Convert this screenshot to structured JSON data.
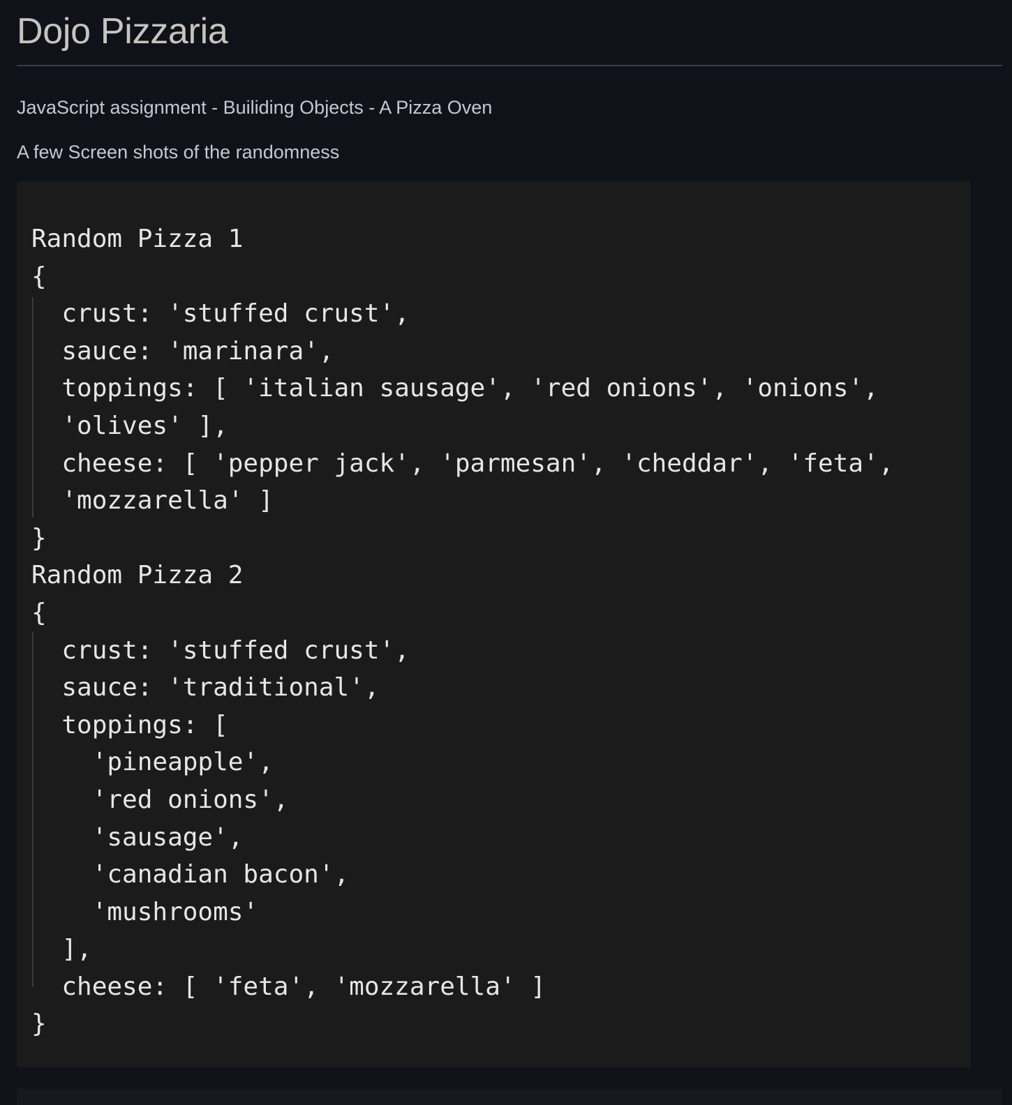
{
  "page": {
    "title": "Dojo Pizzaria",
    "paragraphs": [
      "JavaScript assignment - Builiding Objects - A Pizza Oven",
      "A few Screen shots of the randomness"
    ]
  },
  "code": {
    "lines": [
      "Random Pizza 1",
      "{",
      "  crust: 'stuffed crust',",
      "  sauce: 'marinara',",
      "  toppings: [ 'italian sausage', 'red onions', 'onions',",
      "  'olives' ],",
      "  cheese: [ 'pepper jack', 'parmesan', 'cheddar', 'feta',",
      "  'mozzarella' ]",
      "}",
      "Random Pizza 2",
      "{",
      "  crust: 'stuffed crust',",
      "  sauce: 'traditional',",
      "  toppings: [",
      "    'pineapple',",
      "    'red onions',",
      "    'sausage',",
      "    'canadian bacon',",
      "    'mushrooms'",
      "  ],",
      "  cheese: [ 'feta', 'mozzarella' ]",
      "}"
    ]
  },
  "colors": {
    "background": "#10121a",
    "code_background": "#1b1b1c",
    "title": "#c7c4bd",
    "text": "#c4c9d0",
    "code_text": "#e6e6e6"
  }
}
